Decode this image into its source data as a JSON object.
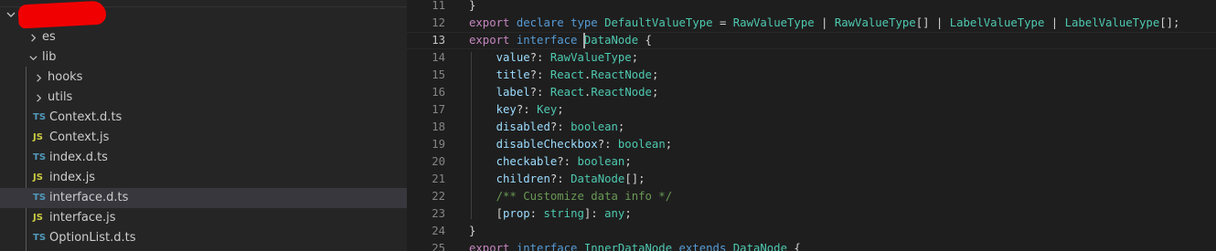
{
  "explorer": {
    "root_label": "redacted",
    "items": [
      {
        "type": "folder",
        "label": "es",
        "expanded": false,
        "level": 1
      },
      {
        "type": "folder",
        "label": "lib",
        "expanded": true,
        "level": 1
      },
      {
        "type": "folder",
        "label": "hooks",
        "expanded": false,
        "level": 2
      },
      {
        "type": "folder",
        "label": "utils",
        "expanded": false,
        "level": 2
      },
      {
        "type": "file",
        "icon": "TS",
        "label": "Context.d.ts",
        "level": 2
      },
      {
        "type": "file",
        "icon": "JS",
        "label": "Context.js",
        "level": 2
      },
      {
        "type": "file",
        "icon": "TS",
        "label": "index.d.ts",
        "level": 2
      },
      {
        "type": "file",
        "icon": "JS",
        "label": "index.js",
        "level": 2
      },
      {
        "type": "file",
        "icon": "TS",
        "label": "interface.d.ts",
        "level": 2,
        "selected": true
      },
      {
        "type": "file",
        "icon": "JS",
        "label": "interface.js",
        "level": 2
      },
      {
        "type": "file",
        "icon": "TS",
        "label": "OptionList.d.ts",
        "level": 2
      }
    ]
  },
  "editor": {
    "current_line": "13",
    "lines": [
      {
        "n": "11",
        "tokens": [
          {
            "t": "}",
            "c": ""
          }
        ]
      },
      {
        "n": "12",
        "tokens": [
          {
            "t": "export",
            "c": "kw2"
          },
          {
            "t": " ",
            "c": ""
          },
          {
            "t": "declare",
            "c": "kw"
          },
          {
            "t": " ",
            "c": ""
          },
          {
            "t": "type",
            "c": "kw"
          },
          {
            "t": " ",
            "c": ""
          },
          {
            "t": "DefaultValueType",
            "c": "ty"
          },
          {
            "t": " = ",
            "c": ""
          },
          {
            "t": "RawValueType",
            "c": "ty"
          },
          {
            "t": " | ",
            "c": ""
          },
          {
            "t": "RawValueType",
            "c": "ty"
          },
          {
            "t": "[] | ",
            "c": ""
          },
          {
            "t": "LabelValueType",
            "c": "ty"
          },
          {
            "t": " | ",
            "c": ""
          },
          {
            "t": "LabelValueType",
            "c": "ty"
          },
          {
            "t": "[];",
            "c": ""
          }
        ]
      },
      {
        "n": "13",
        "tokens": [
          {
            "t": "export",
            "c": "kw2"
          },
          {
            "t": " ",
            "c": ""
          },
          {
            "t": "interface",
            "c": "kw"
          },
          {
            "t": " ",
            "c": ""
          },
          {
            "t": "DataNode",
            "c": "ty"
          },
          {
            "t": " {",
            "c": ""
          }
        ]
      },
      {
        "n": "14",
        "tokens": [
          {
            "t": "    ",
            "c": ""
          },
          {
            "t": "value",
            "c": "pr"
          },
          {
            "t": "?: ",
            "c": ""
          },
          {
            "t": "RawValueType",
            "c": "ty"
          },
          {
            "t": ";",
            "c": ""
          }
        ]
      },
      {
        "n": "15",
        "tokens": [
          {
            "t": "    ",
            "c": ""
          },
          {
            "t": "title",
            "c": "pr"
          },
          {
            "t": "?: ",
            "c": ""
          },
          {
            "t": "React",
            "c": "ty"
          },
          {
            "t": ".",
            "c": ""
          },
          {
            "t": "ReactNode",
            "c": "ty"
          },
          {
            "t": ";",
            "c": ""
          }
        ]
      },
      {
        "n": "16",
        "tokens": [
          {
            "t": "    ",
            "c": ""
          },
          {
            "t": "label",
            "c": "pr"
          },
          {
            "t": "?: ",
            "c": ""
          },
          {
            "t": "React",
            "c": "ty"
          },
          {
            "t": ".",
            "c": ""
          },
          {
            "t": "ReactNode",
            "c": "ty"
          },
          {
            "t": ";",
            "c": ""
          }
        ]
      },
      {
        "n": "17",
        "tokens": [
          {
            "t": "    ",
            "c": ""
          },
          {
            "t": "key",
            "c": "pr"
          },
          {
            "t": "?: ",
            "c": ""
          },
          {
            "t": "Key",
            "c": "ty"
          },
          {
            "t": ";",
            "c": ""
          }
        ]
      },
      {
        "n": "18",
        "tokens": [
          {
            "t": "    ",
            "c": ""
          },
          {
            "t": "disabled",
            "c": "pr"
          },
          {
            "t": "?: ",
            "c": ""
          },
          {
            "t": "boolean",
            "c": "ty"
          },
          {
            "t": ";",
            "c": ""
          }
        ]
      },
      {
        "n": "19",
        "tokens": [
          {
            "t": "    ",
            "c": ""
          },
          {
            "t": "disableCheckbox",
            "c": "pr"
          },
          {
            "t": "?: ",
            "c": ""
          },
          {
            "t": "boolean",
            "c": "ty"
          },
          {
            "t": ";",
            "c": ""
          }
        ]
      },
      {
        "n": "20",
        "tokens": [
          {
            "t": "    ",
            "c": ""
          },
          {
            "t": "checkable",
            "c": "pr"
          },
          {
            "t": "?: ",
            "c": ""
          },
          {
            "t": "boolean",
            "c": "ty"
          },
          {
            "t": ";",
            "c": ""
          }
        ]
      },
      {
        "n": "21",
        "tokens": [
          {
            "t": "    ",
            "c": ""
          },
          {
            "t": "children",
            "c": "pr"
          },
          {
            "t": "?: ",
            "c": ""
          },
          {
            "t": "DataNode",
            "c": "ty"
          },
          {
            "t": "[];",
            "c": ""
          }
        ]
      },
      {
        "n": "22",
        "tokens": [
          {
            "t": "    ",
            "c": ""
          },
          {
            "t": "/** Customize data info */",
            "c": "cm"
          }
        ]
      },
      {
        "n": "23",
        "tokens": [
          {
            "t": "    [",
            "c": ""
          },
          {
            "t": "prop",
            "c": "pr"
          },
          {
            "t": ": ",
            "c": ""
          },
          {
            "t": "string",
            "c": "ty"
          },
          {
            "t": "]: ",
            "c": ""
          },
          {
            "t": "any",
            "c": "ty"
          },
          {
            "t": ";",
            "c": ""
          }
        ]
      },
      {
        "n": "24",
        "tokens": [
          {
            "t": "}",
            "c": ""
          }
        ]
      },
      {
        "n": "25",
        "tokens": [
          {
            "t": "export",
            "c": "kw2"
          },
          {
            "t": " ",
            "c": ""
          },
          {
            "t": "interface",
            "c": "kw"
          },
          {
            "t": " ",
            "c": ""
          },
          {
            "t": "InnerDataNode",
            "c": "ty"
          },
          {
            "t": " ",
            "c": ""
          },
          {
            "t": "extends",
            "c": "kw"
          },
          {
            "t": " ",
            "c": ""
          },
          {
            "t": "DataNode",
            "c": "ty"
          },
          {
            "t": " {",
            "c": ""
          }
        ]
      }
    ]
  },
  "colors": {
    "sidebar_bg": "#252526",
    "editor_bg": "#1e1e1e",
    "selected_row": "#37373d",
    "ts_icon": "#519aba",
    "js_icon": "#cbcb41",
    "redaction": "#f00000"
  }
}
